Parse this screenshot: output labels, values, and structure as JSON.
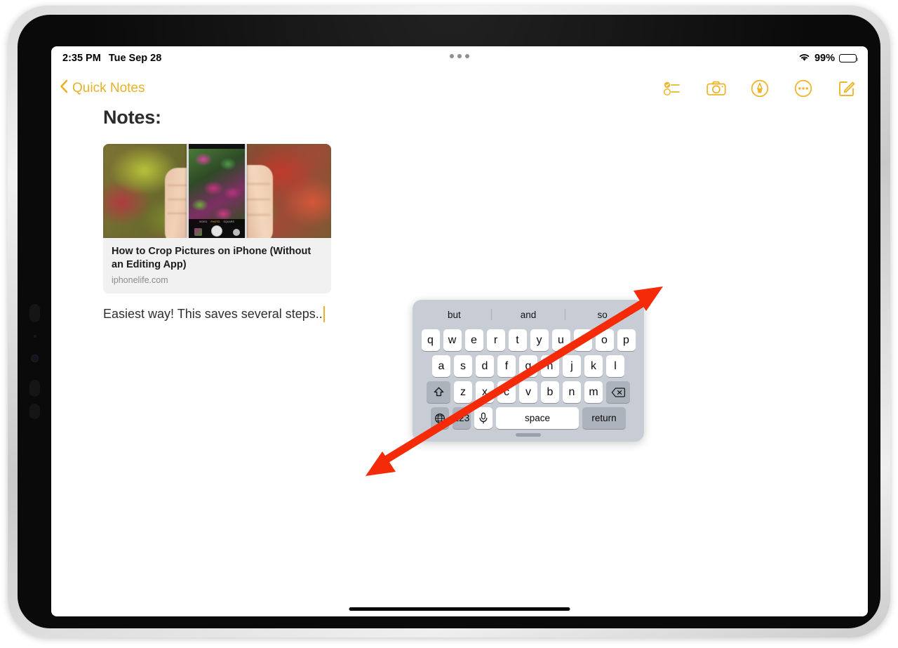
{
  "status_bar": {
    "time": "2:35 PM",
    "date": "Tue Sep 28",
    "battery_percent": "99%",
    "wifi_icon": "wifi-icon",
    "battery_icon": "battery-icon",
    "multitask_icon": "multitasking-dots-icon"
  },
  "nav": {
    "back_label": "Quick Notes",
    "back_chevron_icon": "chevron-left-icon",
    "actions": [
      {
        "name": "checklist-icon",
        "label": "Checklist"
      },
      {
        "name": "camera-icon",
        "label": "Camera"
      },
      {
        "name": "markup-pen-icon",
        "label": "Markup"
      },
      {
        "name": "more-ellipsis-icon",
        "label": "More"
      },
      {
        "name": "compose-icon",
        "label": "New Note"
      }
    ]
  },
  "note": {
    "title": "Notes:",
    "link_preview": {
      "title": "How to Crop Pictures on iPhone (Without an Editing App)",
      "domain": "iphonelife.com",
      "thumbnail_alt": "Hands holding an iPhone photographing magenta autumn leaves",
      "phone_modes": {
        "left": "VIDEO",
        "selected": "PHOTO",
        "right": "SQUARE"
      }
    },
    "body_text": "Easiest way! This saves several steps.."
  },
  "keyboard": {
    "predictions": [
      "but",
      "and",
      "so"
    ],
    "row1": [
      "q",
      "w",
      "e",
      "r",
      "t",
      "y",
      "u",
      "i",
      "o",
      "p"
    ],
    "row2": [
      "a",
      "s",
      "d",
      "f",
      "g",
      "h",
      "j",
      "k",
      "l"
    ],
    "row3_letters": [
      "z",
      "x",
      "c",
      "v",
      "b",
      "n",
      "m"
    ],
    "shift_icon": "shift-arrow-icon",
    "backspace_icon": "backspace-delete-icon",
    "globe_icon": "globe-language-icon",
    "numbers_label": "123",
    "mic_icon": "microphone-icon",
    "space_label": "space",
    "return_label": "return",
    "handle_icon": "keyboard-drag-handle"
  },
  "annotation": {
    "arrow_color": "#f42a08",
    "arrow_label": "double-headed-diagonal-arrow"
  },
  "colors": {
    "accent_yellow": "#e8b228",
    "keyboard_bg": "#c8ccd4",
    "key_white": "#ffffff",
    "key_gray": "#adb3bd"
  }
}
